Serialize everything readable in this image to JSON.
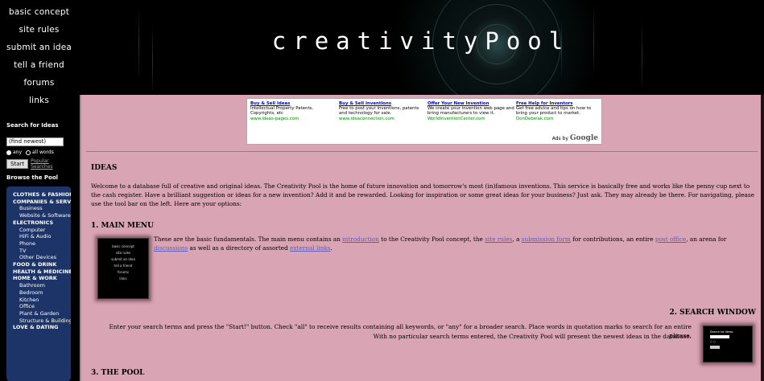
{
  "nav": {
    "links": [
      "basic concept",
      "site rules",
      "submit an idea",
      "tell a friend",
      "forums",
      "links"
    ]
  },
  "search": {
    "label": "Search for Ideas",
    "value": "(find newest)",
    "option_any": "any",
    "option_all": "all words",
    "start_label": "Start",
    "popular_label": "Popular Searches"
  },
  "browse": {
    "label": "Browse the Pool",
    "categories": [
      {
        "label": "Clothes & Fashion",
        "level": "top"
      },
      {
        "label": "Companies & Services",
        "level": "top"
      },
      {
        "label": "Business",
        "level": "sub"
      },
      {
        "label": "Website & Software",
        "level": "sub"
      },
      {
        "label": "Electronics",
        "level": "top"
      },
      {
        "label": "Computer",
        "level": "sub"
      },
      {
        "label": "HiFi & Audio",
        "level": "sub"
      },
      {
        "label": "Phone",
        "level": "sub"
      },
      {
        "label": "TV",
        "level": "sub"
      },
      {
        "label": "Other Devices",
        "level": "sub"
      },
      {
        "label": "Food & Drink",
        "level": "top"
      },
      {
        "label": "Health & Medicine",
        "level": "top"
      },
      {
        "label": "Home & Work",
        "level": "top"
      },
      {
        "label": "Bathroom",
        "level": "sub"
      },
      {
        "label": "Bedroom",
        "level": "sub"
      },
      {
        "label": "Kitchen",
        "level": "sub"
      },
      {
        "label": "Office",
        "level": "sub"
      },
      {
        "label": "Plant & Garden",
        "level": "sub"
      },
      {
        "label": "Structure & Building",
        "level": "sub"
      },
      {
        "label": "Love & Dating",
        "level": "top"
      }
    ]
  },
  "header": {
    "logo": "creativityPool"
  },
  "ads": [
    {
      "title": "Buy & Sell Ideas",
      "desc": "Intellectual Property Patents, Copyrights, etc",
      "url": "www.ideas-pages.com"
    },
    {
      "title": "Buy & Sell Inventions",
      "desc": "Free to post your inventions, patents and technology for sale.",
      "url": "www.ideaconnection.com"
    },
    {
      "title": "Offer Your New Invention",
      "desc": "We create your invention web page and bring manufacturers to view it.",
      "url": "WorldInventionCenter.com"
    },
    {
      "title": "Free Help for Inventors",
      "desc": "Get free advice and tips on how to bring your product to market.",
      "url": "DonDebelak.com"
    }
  ],
  "ads_by": "Ads by",
  "ads_brand": "Google",
  "content": {
    "ideas_heading": "IDEAS",
    "intro": "Welcome to a database full of creative and original ideas. The Creativity Pool is the home of future innovation and tomorrow's most (in)famous inventions. This service is basically free and works like the penny cup next to the cash register. Have a brilliant suggestion or ideas for a new invention? Add it and be rewarded. Looking for inspiration or some great ideas for your business? Just ask. They may already be there. For navigating, please use the tool bar on the left. Here are your options:",
    "main_menu_heading": "1. MAIN MENU",
    "main_menu_text": {
      "p1": "These are the basic fundamentals. The main menu contains an ",
      "l1": "introduction",
      "p2": " to the Creativity Pool concept, the ",
      "l2": "site rules",
      "p3": ", a ",
      "l3": "submission form",
      "p4": " for contributions, an entire ",
      "l4": "post office",
      "p5": ", an arena for ",
      "l5": "discussions",
      "p6": " as well as a directory of assorted ",
      "l6": "external links",
      "p7": "."
    },
    "search_heading": "2. SEARCH WINDOW",
    "search_text_1": "Enter your search terms and press the \"Start!\" button. Check \"all\" to receive results containing all keywords, or \"any\" for a broader search. Place words in quotation marks to search for an entire phrase.",
    "search_text_2": "With no particular search terms entered, the Creativity Pool will present the newest ideas in the database.",
    "pool_heading": "3. THE POOL"
  },
  "thumb_menu": [
    "basic concept",
    "site rules",
    "submit an idea",
    "tell a friend",
    "forums",
    "links"
  ]
}
